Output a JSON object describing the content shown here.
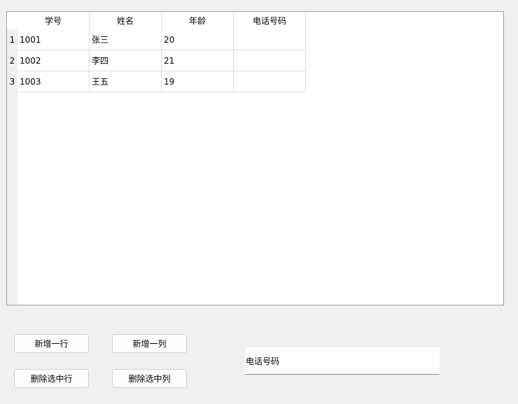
{
  "table": {
    "columns": [
      "学号",
      "姓名",
      "年龄",
      "电话号码"
    ],
    "rows": [
      {
        "header": "1",
        "cells": [
          "1001",
          "张三",
          "20",
          ""
        ]
      },
      {
        "header": "2",
        "cells": [
          "1002",
          "李四",
          "21",
          ""
        ]
      },
      {
        "header": "3",
        "cells": [
          "1003",
          "王五",
          "19",
          ""
        ]
      }
    ]
  },
  "buttons": {
    "add_row": "新增一行",
    "add_column": "新增一列",
    "delete_selected_row": "删除选中行",
    "delete_selected_column": "删除选中列"
  },
  "input": {
    "value": "电话号码"
  }
}
